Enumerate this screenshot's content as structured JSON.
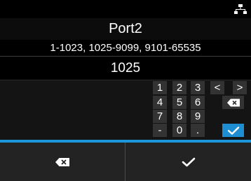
{
  "header": {
    "title": "Port2",
    "range": "1-1023, 1025-9099, 9101-65535",
    "value": "1025",
    "status_icon": "network-icon"
  },
  "keypad": {
    "row1": [
      "1",
      "2",
      "3",
      "<",
      ">"
    ],
    "row2": [
      "4",
      "5",
      "6"
    ],
    "row3": [
      "7",
      "8",
      "9"
    ],
    "row4": [
      "-",
      "0",
      "."
    ],
    "icons": {
      "backspace": "backspace-icon",
      "enter": "checkmark-icon"
    }
  },
  "softkeys": {
    "left_icon": "backspace-icon",
    "right_icon": "checkmark-icon"
  },
  "colors": {
    "accent": "#1e96db",
    "key_bg": "#333333",
    "enter_bg": "#1d8ed1"
  }
}
